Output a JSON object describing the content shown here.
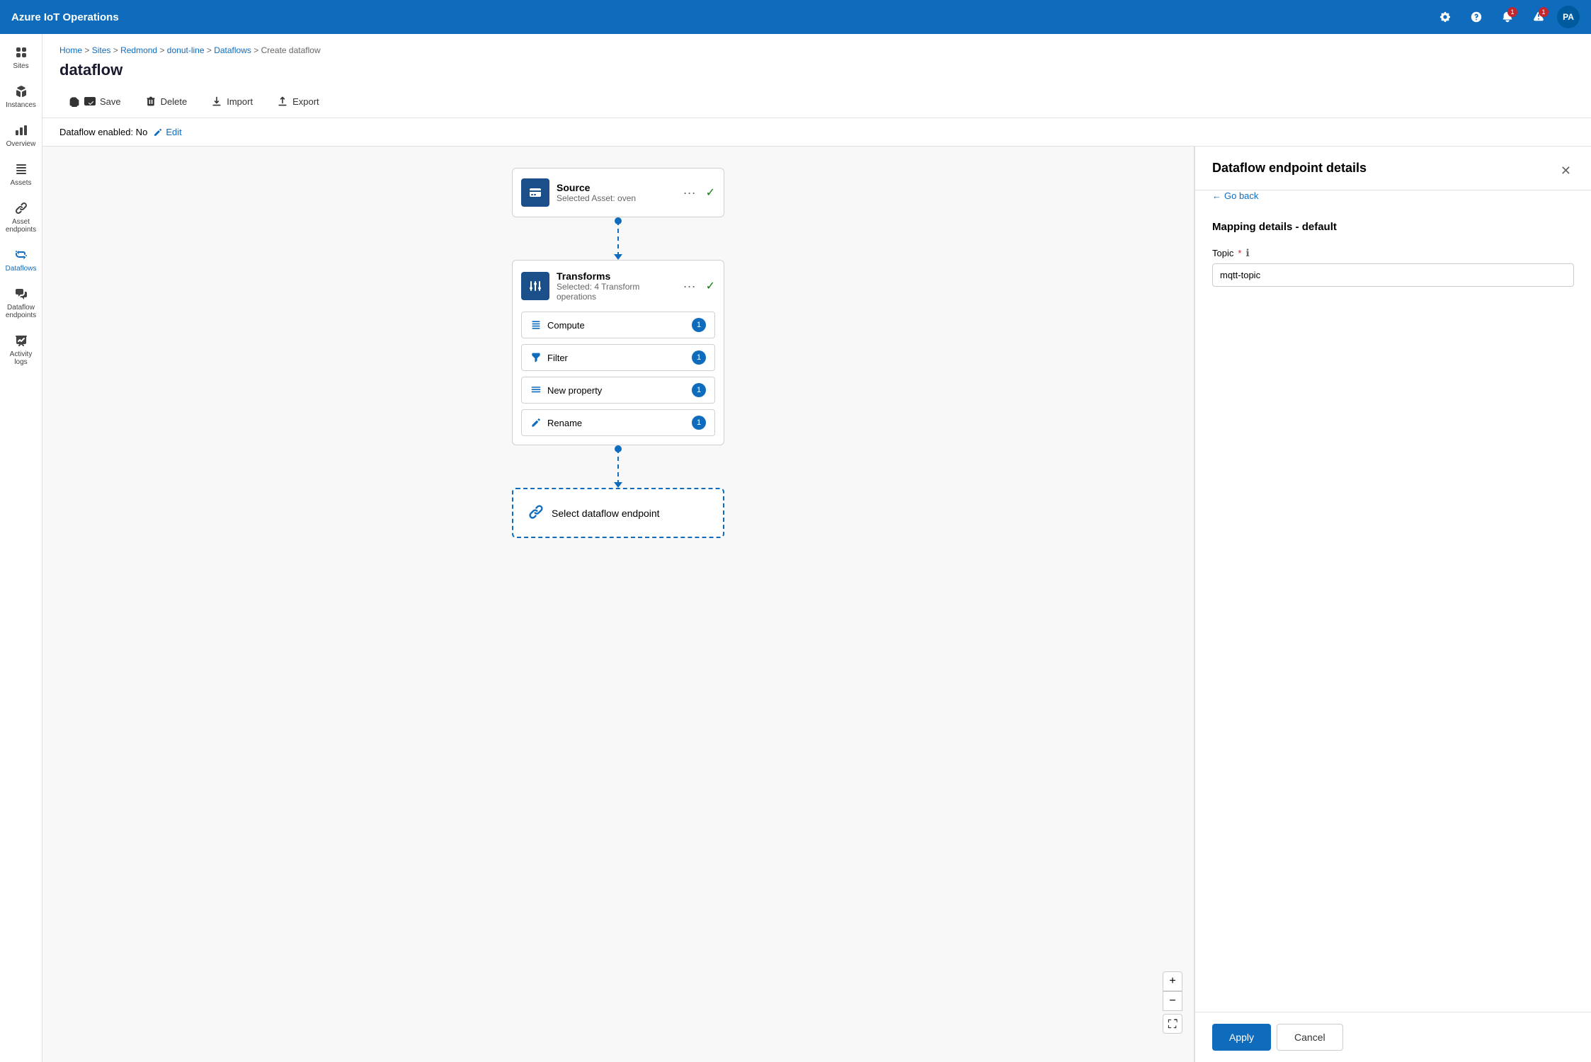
{
  "app": {
    "title": "Azure IoT Operations"
  },
  "topbar": {
    "title": "Azure IoT Operations",
    "icons": {
      "settings": "⚙",
      "help": "?",
      "notifications": "🔔",
      "alerts": "🔔",
      "avatar": "PA"
    },
    "badges": {
      "notifications": "1",
      "alerts": "1"
    }
  },
  "sidebar": {
    "items": [
      {
        "id": "sites",
        "label": "Sites",
        "icon": "grid"
      },
      {
        "id": "instances",
        "label": "Instances",
        "icon": "cube"
      },
      {
        "id": "overview",
        "label": "Overview",
        "icon": "chart"
      },
      {
        "id": "assets",
        "label": "Assets",
        "icon": "asset"
      },
      {
        "id": "asset-endpoints",
        "label": "Asset endpoints",
        "icon": "endpoint"
      },
      {
        "id": "dataflows",
        "label": "Dataflows",
        "icon": "dataflow",
        "active": true
      },
      {
        "id": "dataflow-endpoints",
        "label": "Dataflow endpoints",
        "icon": "dataflow-ep"
      },
      {
        "id": "activity-logs",
        "label": "Activity logs",
        "icon": "log"
      }
    ]
  },
  "breadcrumb": {
    "items": [
      "Home",
      "Sites",
      "Redmond",
      "donut-line",
      "Dataflows",
      "Create dataflow"
    ]
  },
  "page": {
    "title": "dataflow"
  },
  "toolbar": {
    "save_label": "Save",
    "delete_label": "Delete",
    "import_label": "Import",
    "export_label": "Export"
  },
  "status_bar": {
    "text": "Dataflow enabled: No",
    "edit_label": "Edit"
  },
  "flow": {
    "source_node": {
      "title": "Source",
      "subtitle": "Selected Asset: oven"
    },
    "transform_node": {
      "title": "Transforms",
      "subtitle": "Selected: 4 Transform operations",
      "items": [
        {
          "id": "compute",
          "label": "Compute",
          "count": "1"
        },
        {
          "id": "filter",
          "label": "Filter",
          "count": "1"
        },
        {
          "id": "new-property",
          "label": "New property",
          "count": "1"
        },
        {
          "id": "rename",
          "label": "Rename",
          "count": "1"
        }
      ]
    },
    "endpoint_node": {
      "label": "Select dataflow endpoint"
    }
  },
  "right_panel": {
    "title": "Dataflow endpoint details",
    "go_back": "Go back",
    "close_icon": "✕",
    "mapping_title": "Mapping details",
    "mapping_subtitle": "default",
    "topic_label": "Topic",
    "topic_placeholder": "",
    "topic_value": "mqtt-topic",
    "apply_label": "Apply",
    "cancel_label": "Cancel"
  }
}
